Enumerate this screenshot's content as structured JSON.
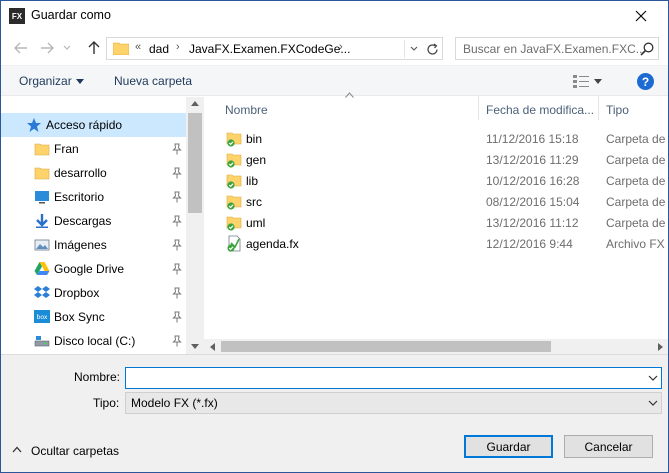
{
  "window": {
    "title": "Guardar como",
    "app_icon_text": "FX"
  },
  "address": {
    "overflow": "«",
    "segments": [
      "dad",
      "JavaFX.Examen.FXCodeGe..."
    ],
    "separator": "›"
  },
  "search": {
    "placeholder": "Buscar en JavaFX.Examen.FXC..."
  },
  "toolbar": {
    "organize_label": "Organizar",
    "new_folder_label": "Nueva carpeta",
    "help_label": "?"
  },
  "sidebar": {
    "quick_access": "Acceso rápido",
    "items": [
      {
        "label": "Fran",
        "icon": "folder-icon",
        "pinned": true
      },
      {
        "label": "desarrollo",
        "icon": "folder-icon",
        "pinned": true
      },
      {
        "label": "Escritorio",
        "icon": "desktop-icon",
        "pinned": true
      },
      {
        "label": "Descargas",
        "icon": "download-icon",
        "pinned": true
      },
      {
        "label": "Imágenes",
        "icon": "pictures-icon",
        "pinned": true
      },
      {
        "label": "Google Drive",
        "icon": "google-drive-icon",
        "pinned": true
      },
      {
        "label": "Dropbox",
        "icon": "dropbox-icon",
        "pinned": true
      },
      {
        "label": "Box Sync",
        "icon": "box-sync-icon",
        "pinned": true
      },
      {
        "label": "Disco local (C:)",
        "icon": "drive-icon",
        "pinned": true
      }
    ]
  },
  "columns": {
    "name": "Nombre",
    "date": "Fecha de modifica...",
    "type": "Tipo"
  },
  "files": [
    {
      "name": "bin",
      "date": "11/12/2016 15:18",
      "type": "Carpeta de a",
      "kind": "folder"
    },
    {
      "name": "gen",
      "date": "13/12/2016 11:29",
      "type": "Carpeta de a",
      "kind": "folder"
    },
    {
      "name": "lib",
      "date": "10/12/2016 16:28",
      "type": "Carpeta de a",
      "kind": "folder"
    },
    {
      "name": "src",
      "date": "08/12/2016 15:04",
      "type": "Carpeta de a",
      "kind": "folder"
    },
    {
      "name": "uml",
      "date": "13/12/2016 11:12",
      "type": "Carpeta de a",
      "kind": "folder"
    },
    {
      "name": "agenda.fx",
      "date": "12/12/2016 9:44",
      "type": "Archivo FX",
      "kind": "file"
    }
  ],
  "form": {
    "name_label": "Nombre:",
    "name_value": "",
    "type_label": "Tipo:",
    "type_value": "Modelo FX (*.fx)"
  },
  "footer": {
    "hide_folders": "Ocultar carpetas",
    "save": "Guardar",
    "cancel": "Cancelar"
  },
  "colors": {
    "accent": "#0078d7",
    "selection": "#cce8ff",
    "folder": "#ffd36b",
    "check": "#3ea53e"
  }
}
